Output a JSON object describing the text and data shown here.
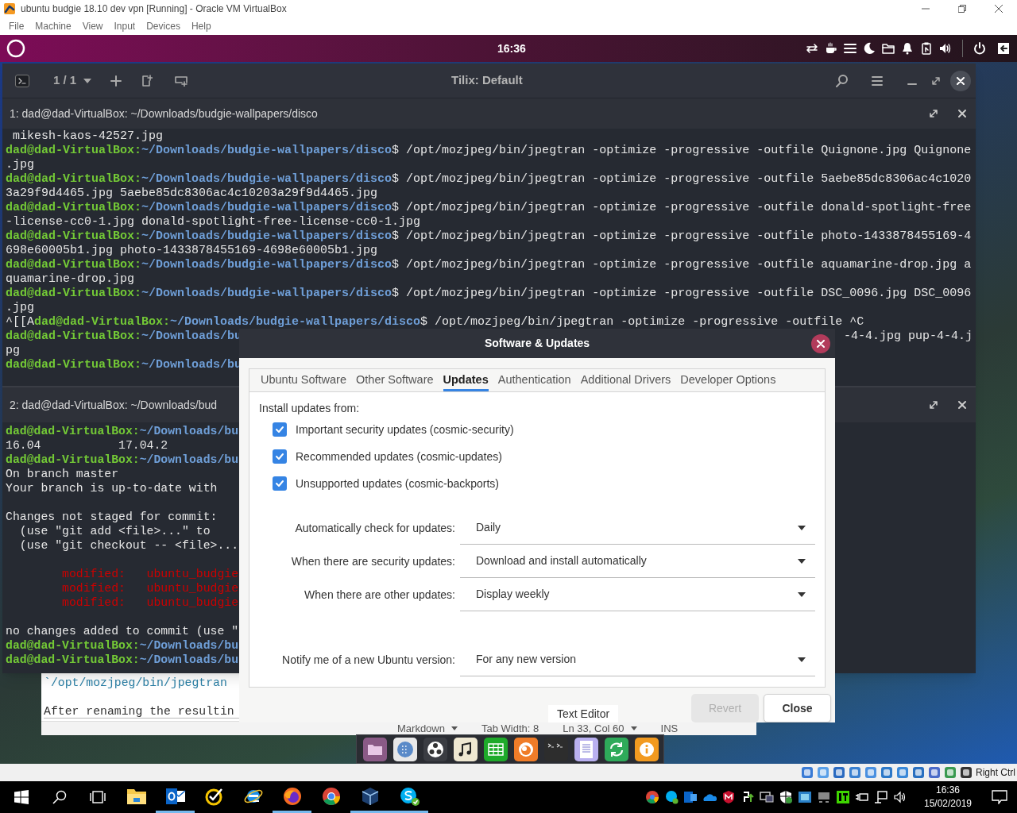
{
  "vbox": {
    "title": "ubuntu budgie 18.10 dev vpn [Running] - Oracle VM VirtualBox",
    "menu": [
      "File",
      "Machine",
      "View",
      "Input",
      "Devices",
      "Help"
    ],
    "host_key": "Right Ctrl"
  },
  "panel": {
    "clock": "16:36"
  },
  "tilix": {
    "title": "Tilix: Default",
    "session": "1 / 1",
    "panes": [
      {
        "title": "1: dad@dad-VirtualBox: ~/Downloads/budgie-wallpapers/disco",
        "lines": [
          {
            "kind": "normal",
            "text": " mikesh-kaos-42527.jpg"
          },
          {
            "kind": "normal",
            "user": "dad@dad-VirtualBox:",
            "path": "~/Downloads/budgie-wallpapers/disco",
            "text": "$ /opt/mozjpeg/bin/jpegtran -optimize -progressive -outfile Quignone.jpg Quignone"
          },
          {
            "kind": "normal",
            "text": ".jpg"
          },
          {
            "kind": "normal",
            "user": "dad@dad-VirtualBox:",
            "path": "~/Downloads/budgie-wallpapers/disco",
            "text": "$ /opt/mozjpeg/bin/jpegtran -optimize -progressive -outfile 5aebe85dc8306ac4c1020"
          },
          {
            "kind": "normal",
            "text": "3a29f9d4465.jpg 5aebe85dc8306ac4c10203a29f9d4465.jpg"
          },
          {
            "kind": "normal",
            "user": "dad@dad-VirtualBox:",
            "path": "~/Downloads/budgie-wallpapers/disco",
            "text": "$ /opt/mozjpeg/bin/jpegtran -optimize -progressive -outfile donald-spotlight-free"
          },
          {
            "kind": "normal",
            "text": "-license-cc0-1.jpg donald-spotlight-free-license-cc0-1.jpg"
          },
          {
            "kind": "normal",
            "user": "dad@dad-VirtualBox:",
            "path": "~/Downloads/budgie-wallpapers/disco",
            "text": "$ /opt/mozjpeg/bin/jpegtran -optimize -progressive -outfile photo-1433878455169-4"
          },
          {
            "kind": "normal",
            "text": "698e60005b1.jpg photo-1433878455169-4698e60005b1.jpg"
          },
          {
            "kind": "normal",
            "user": "dad@dad-VirtualBox:",
            "path": "~/Downloads/budgie-wallpapers/disco",
            "text": "$ /opt/mozjpeg/bin/jpegtran -optimize -progressive -outfile aquamarine-drop.jpg a"
          },
          {
            "kind": "normal",
            "text": "quamarine-drop.jpg"
          },
          {
            "kind": "normal",
            "user": "dad@dad-VirtualBox:",
            "path": "~/Downloads/budgie-wallpapers/disco",
            "text": "$ /opt/mozjpeg/bin/jpegtran -optimize -progressive -outfile DSC_0096.jpg DSC_0096"
          },
          {
            "kind": "normal",
            "text": ".jpg"
          },
          {
            "kind": "normal",
            "pre": "^[[A",
            "user": "dad@dad-VirtualBox:",
            "path": "~/Downloads/budgie-wallpapers/disco",
            "text": "$ /opt/mozjpeg/bin/jpegtran -optimize -progressive -outfile ^C"
          },
          {
            "kind": "normal",
            "user": "dad@dad-VirtualBox:",
            "path": "~/Downloads/bu",
            "tail": "-4-4.jpg pup-4-4.j"
          },
          {
            "kind": "normal",
            "text": "pg"
          },
          {
            "kind": "normal",
            "user": "dad@dad-VirtualBox:",
            "path": "~/Downloads/bu"
          }
        ]
      },
      {
        "title": "2: dad@dad-VirtualBox: ~/Downloads/bud",
        "lines": [
          {
            "kind": "normal",
            "user": "dad@dad-VirtualBox:",
            "path": "~/Downloads/bu"
          },
          {
            "kind": "normal",
            "text": "16.04           17.04.2"
          },
          {
            "kind": "normal",
            "user": "dad@dad-VirtualBox:",
            "path": "~/Downloads/bu"
          },
          {
            "kind": "normal",
            "text": "On branch master"
          },
          {
            "kind": "normal",
            "text": "Your branch is up-to-date with"
          },
          {
            "kind": "blank"
          },
          {
            "kind": "normal",
            "text": "Changes not staged for commit:"
          },
          {
            "kind": "normal",
            "text": "  (use \"git add <file>...\" to"
          },
          {
            "kind": "normal",
            "text": "  (use \"git checkout -- <file>..."
          },
          {
            "kind": "blank"
          },
          {
            "kind": "modified",
            "text": "        modified:   ubuntu_budgie"
          },
          {
            "kind": "modified",
            "text": "        modified:   ubuntu_budgie"
          },
          {
            "kind": "modified",
            "text": "        modified:   ubuntu_budgie"
          },
          {
            "kind": "blank"
          },
          {
            "kind": "normal",
            "text": "no changes added to commit (use \""
          },
          {
            "kind": "normal",
            "user": "dad@dad-VirtualBox:",
            "path": "~/Downloads/bu"
          },
          {
            "kind": "normal",
            "user": "dad@dad-VirtualBox:",
            "path": "~/Downloads/bu"
          }
        ]
      }
    ]
  },
  "text_editor": {
    "lines": [
      {
        "kind": "code",
        "text": "`/opt/mozjpeg/bin/jpegtran"
      },
      {
        "kind": "blank"
      },
      {
        "kind": "plain",
        "text": "After renaming the resultin"
      }
    ],
    "status": [
      {
        "text": "Markdown",
        "dropdown": true
      },
      {
        "text": "Tab Width: 8",
        "dropdown": false
      },
      {
        "text": "Ln 33, Col 60",
        "dropdown": true
      },
      {
        "text": "INS",
        "dropdown": false
      }
    ]
  },
  "dialog": {
    "title": "Software & Updates",
    "tabs": [
      {
        "label": "Ubuntu Software",
        "selected": false
      },
      {
        "label": "Other Software",
        "selected": false
      },
      {
        "label": "Updates",
        "selected": true
      },
      {
        "label": "Authentication",
        "selected": false
      },
      {
        "label": "Additional Drivers",
        "selected": false
      },
      {
        "label": "Developer Options",
        "selected": false
      }
    ],
    "section_label": "Install updates from:",
    "sources": [
      {
        "label": "Important security updates (cosmic-security)",
        "checked": true
      },
      {
        "label": "Recommended updates (cosmic-updates)",
        "checked": true
      },
      {
        "label": "Unsupported updates (cosmic-backports)",
        "checked": true
      }
    ],
    "update_settings": [
      {
        "label": "Automatically check for updates:",
        "value": "Daily"
      },
      {
        "label": "When there are security updates:",
        "value": "Download and install automatically"
      },
      {
        "label": "When there are other updates:",
        "value": "Display weekly"
      }
    ],
    "release_setting": {
      "label": "Notify me of a new Ubuntu version:",
      "value": "For any new version"
    },
    "buttons": [
      {
        "label": "Revert",
        "disabled": true
      },
      {
        "label": "Close",
        "disabled": false
      }
    ]
  },
  "dock": {
    "tooltip": "Text Editor"
  },
  "taskbar": {
    "apps": [
      {
        "kind": "explorer",
        "running": false
      },
      {
        "kind": "outlook",
        "running": true
      },
      {
        "kind": "norton",
        "running": false
      },
      {
        "kind": "ie",
        "running": false
      },
      {
        "kind": "firefox",
        "running": true
      },
      {
        "kind": "chrome",
        "running": false
      },
      {
        "kind": "virtualbox",
        "running": true
      },
      {
        "kind": "skype",
        "running": true
      }
    ],
    "time": "16:36",
    "date": "15/02/2019"
  }
}
